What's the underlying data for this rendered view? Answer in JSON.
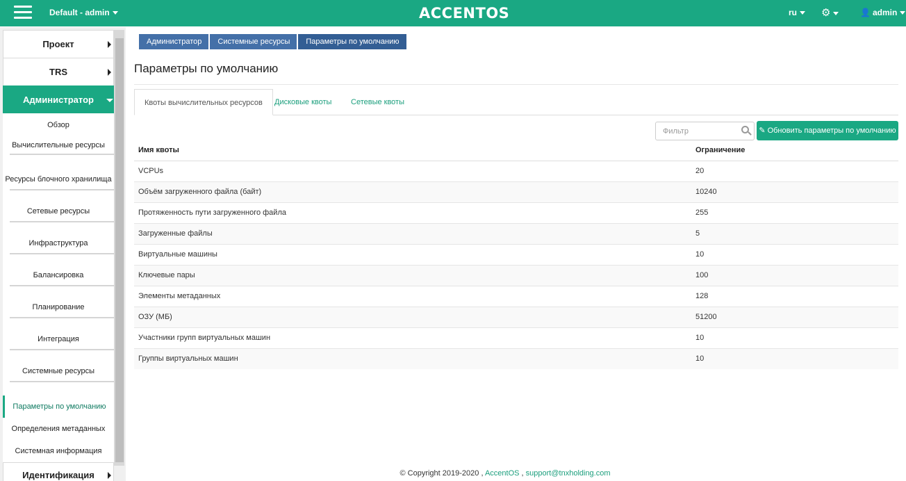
{
  "topbar": {
    "project": "Default - admin",
    "logo": "ACCENTOS",
    "language": "ru",
    "user": "admin",
    "icons": {
      "menu": "hamburger-icon",
      "settings": "gear-icon",
      "user": "user-icon"
    },
    "color": "#1aa883"
  },
  "sidebar": {
    "project": "Проект",
    "trs": "TRS",
    "admin": "Администратор",
    "items": [
      "Обзор",
      "Вычислительные ресурсы",
      "Ресурсы блочного хранилища",
      "Сетевые ресурсы",
      "Инфраструктура",
      "Балансировка",
      "Планирование",
      "Интеграция",
      "Системные ресурсы"
    ],
    "subitems": [
      "Параметры по умолчанию",
      "Определения метаданных",
      "Системная информация"
    ],
    "identity": "Идентификация"
  },
  "breadcrumb": [
    "Администратор",
    "Системные ресурсы",
    "Параметры по умолчанию"
  ],
  "page_title": "Параметры по умолчанию",
  "tabs": [
    "Квоты вычислительных ресурсов",
    "Дисковые квоты",
    "Сетевые квоты"
  ],
  "filter": {
    "placeholder": "Фильтр"
  },
  "update_button": "Обновить параметры по умолчанию",
  "table": {
    "headers": [
      "Имя квоты",
      "Ограничение"
    ],
    "rows": [
      [
        "VCPUs",
        "20"
      ],
      [
        "Объём загруженного файла (байт)",
        "10240"
      ],
      [
        "Протяженность пути загруженного файла",
        "255"
      ],
      [
        "Загруженные файлы",
        "5"
      ],
      [
        "Виртуальные машины",
        "10"
      ],
      [
        "Ключевые пары",
        "100"
      ],
      [
        "Элементы метаданных",
        "128"
      ],
      [
        "ОЗУ (МБ)",
        "51200"
      ],
      [
        "Участники групп виртуальных машин",
        "10"
      ],
      [
        "Группы виртуальных машин",
        "10"
      ]
    ]
  },
  "footer": {
    "copyright": "© Copyright 2019-2020 ,",
    "brand": "AccentOS",
    "sep": ",",
    "email": "support@tnxholding.com"
  }
}
